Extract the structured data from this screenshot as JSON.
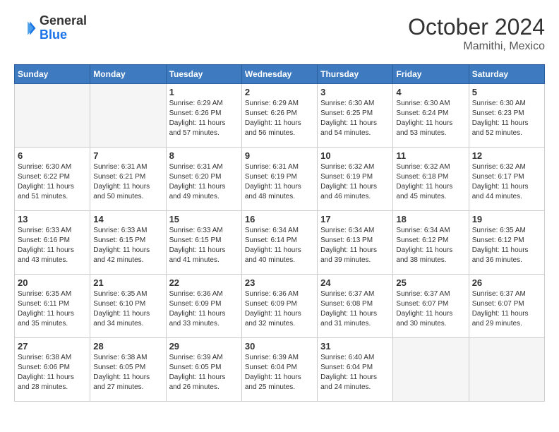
{
  "header": {
    "logo_line1": "General",
    "logo_line2": "Blue",
    "month": "October 2024",
    "location": "Mamithi, Mexico"
  },
  "weekdays": [
    "Sunday",
    "Monday",
    "Tuesday",
    "Wednesday",
    "Thursday",
    "Friday",
    "Saturday"
  ],
  "weeks": [
    [
      {
        "day": "",
        "sunrise": "",
        "sunset": "",
        "daylight": ""
      },
      {
        "day": "",
        "sunrise": "",
        "sunset": "",
        "daylight": ""
      },
      {
        "day": "1",
        "sunrise": "Sunrise: 6:29 AM",
        "sunset": "Sunset: 6:26 PM",
        "daylight": "Daylight: 11 hours and 57 minutes."
      },
      {
        "day": "2",
        "sunrise": "Sunrise: 6:29 AM",
        "sunset": "Sunset: 6:26 PM",
        "daylight": "Daylight: 11 hours and 56 minutes."
      },
      {
        "day": "3",
        "sunrise": "Sunrise: 6:30 AM",
        "sunset": "Sunset: 6:25 PM",
        "daylight": "Daylight: 11 hours and 54 minutes."
      },
      {
        "day": "4",
        "sunrise": "Sunrise: 6:30 AM",
        "sunset": "Sunset: 6:24 PM",
        "daylight": "Daylight: 11 hours and 53 minutes."
      },
      {
        "day": "5",
        "sunrise": "Sunrise: 6:30 AM",
        "sunset": "Sunset: 6:23 PM",
        "daylight": "Daylight: 11 hours and 52 minutes."
      }
    ],
    [
      {
        "day": "6",
        "sunrise": "Sunrise: 6:30 AM",
        "sunset": "Sunset: 6:22 PM",
        "daylight": "Daylight: 11 hours and 51 minutes."
      },
      {
        "day": "7",
        "sunrise": "Sunrise: 6:31 AM",
        "sunset": "Sunset: 6:21 PM",
        "daylight": "Daylight: 11 hours and 50 minutes."
      },
      {
        "day": "8",
        "sunrise": "Sunrise: 6:31 AM",
        "sunset": "Sunset: 6:20 PM",
        "daylight": "Daylight: 11 hours and 49 minutes."
      },
      {
        "day": "9",
        "sunrise": "Sunrise: 6:31 AM",
        "sunset": "Sunset: 6:19 PM",
        "daylight": "Daylight: 11 hours and 48 minutes."
      },
      {
        "day": "10",
        "sunrise": "Sunrise: 6:32 AM",
        "sunset": "Sunset: 6:19 PM",
        "daylight": "Daylight: 11 hours and 46 minutes."
      },
      {
        "day": "11",
        "sunrise": "Sunrise: 6:32 AM",
        "sunset": "Sunset: 6:18 PM",
        "daylight": "Daylight: 11 hours and 45 minutes."
      },
      {
        "day": "12",
        "sunrise": "Sunrise: 6:32 AM",
        "sunset": "Sunset: 6:17 PM",
        "daylight": "Daylight: 11 hours and 44 minutes."
      }
    ],
    [
      {
        "day": "13",
        "sunrise": "Sunrise: 6:33 AM",
        "sunset": "Sunset: 6:16 PM",
        "daylight": "Daylight: 11 hours and 43 minutes."
      },
      {
        "day": "14",
        "sunrise": "Sunrise: 6:33 AM",
        "sunset": "Sunset: 6:15 PM",
        "daylight": "Daylight: 11 hours and 42 minutes."
      },
      {
        "day": "15",
        "sunrise": "Sunrise: 6:33 AM",
        "sunset": "Sunset: 6:15 PM",
        "daylight": "Daylight: 11 hours and 41 minutes."
      },
      {
        "day": "16",
        "sunrise": "Sunrise: 6:34 AM",
        "sunset": "Sunset: 6:14 PM",
        "daylight": "Daylight: 11 hours and 40 minutes."
      },
      {
        "day": "17",
        "sunrise": "Sunrise: 6:34 AM",
        "sunset": "Sunset: 6:13 PM",
        "daylight": "Daylight: 11 hours and 39 minutes."
      },
      {
        "day": "18",
        "sunrise": "Sunrise: 6:34 AM",
        "sunset": "Sunset: 6:12 PM",
        "daylight": "Daylight: 11 hours and 38 minutes."
      },
      {
        "day": "19",
        "sunrise": "Sunrise: 6:35 AM",
        "sunset": "Sunset: 6:12 PM",
        "daylight": "Daylight: 11 hours and 36 minutes."
      }
    ],
    [
      {
        "day": "20",
        "sunrise": "Sunrise: 6:35 AM",
        "sunset": "Sunset: 6:11 PM",
        "daylight": "Daylight: 11 hours and 35 minutes."
      },
      {
        "day": "21",
        "sunrise": "Sunrise: 6:35 AM",
        "sunset": "Sunset: 6:10 PM",
        "daylight": "Daylight: 11 hours and 34 minutes."
      },
      {
        "day": "22",
        "sunrise": "Sunrise: 6:36 AM",
        "sunset": "Sunset: 6:09 PM",
        "daylight": "Daylight: 11 hours and 33 minutes."
      },
      {
        "day": "23",
        "sunrise": "Sunrise: 6:36 AM",
        "sunset": "Sunset: 6:09 PM",
        "daylight": "Daylight: 11 hours and 32 minutes."
      },
      {
        "day": "24",
        "sunrise": "Sunrise: 6:37 AM",
        "sunset": "Sunset: 6:08 PM",
        "daylight": "Daylight: 11 hours and 31 minutes."
      },
      {
        "day": "25",
        "sunrise": "Sunrise: 6:37 AM",
        "sunset": "Sunset: 6:07 PM",
        "daylight": "Daylight: 11 hours and 30 minutes."
      },
      {
        "day": "26",
        "sunrise": "Sunrise: 6:37 AM",
        "sunset": "Sunset: 6:07 PM",
        "daylight": "Daylight: 11 hours and 29 minutes."
      }
    ],
    [
      {
        "day": "27",
        "sunrise": "Sunrise: 6:38 AM",
        "sunset": "Sunset: 6:06 PM",
        "daylight": "Daylight: 11 hours and 28 minutes."
      },
      {
        "day": "28",
        "sunrise": "Sunrise: 6:38 AM",
        "sunset": "Sunset: 6:05 PM",
        "daylight": "Daylight: 11 hours and 27 minutes."
      },
      {
        "day": "29",
        "sunrise": "Sunrise: 6:39 AM",
        "sunset": "Sunset: 6:05 PM",
        "daylight": "Daylight: 11 hours and 26 minutes."
      },
      {
        "day": "30",
        "sunrise": "Sunrise: 6:39 AM",
        "sunset": "Sunset: 6:04 PM",
        "daylight": "Daylight: 11 hours and 25 minutes."
      },
      {
        "day": "31",
        "sunrise": "Sunrise: 6:40 AM",
        "sunset": "Sunset: 6:04 PM",
        "daylight": "Daylight: 11 hours and 24 minutes."
      },
      {
        "day": "",
        "sunrise": "",
        "sunset": "",
        "daylight": ""
      },
      {
        "day": "",
        "sunrise": "",
        "sunset": "",
        "daylight": ""
      }
    ]
  ]
}
